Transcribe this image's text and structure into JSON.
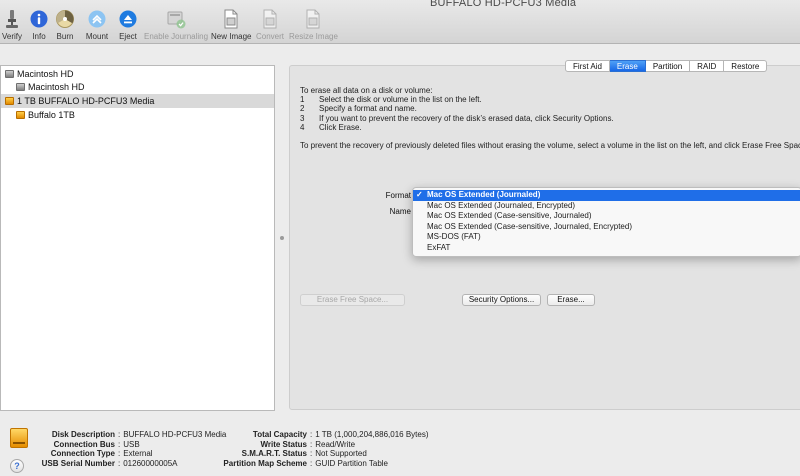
{
  "window": {
    "title": "BUFFALO HD-PCFU3 Media"
  },
  "toolbar": {
    "items": [
      {
        "label": "Verify",
        "icon": "microscope-icon",
        "enabled": true
      },
      {
        "label": "Info",
        "icon": "info-icon",
        "enabled": true
      },
      {
        "label": "Burn",
        "icon": "burn-icon",
        "enabled": true
      },
      {
        "label": "Mount",
        "icon": "mount-icon",
        "enabled": true
      },
      {
        "label": "Eject",
        "icon": "eject-icon",
        "enabled": true
      },
      {
        "label": "Enable Journaling",
        "icon": "journaling-icon",
        "enabled": false
      },
      {
        "label": "New Image",
        "icon": "new-image-icon",
        "enabled": true
      },
      {
        "label": "Convert",
        "icon": "convert-icon",
        "enabled": false
      },
      {
        "label": "Resize Image",
        "icon": "resize-image-icon",
        "enabled": false
      }
    ]
  },
  "sidebar": {
    "items": [
      {
        "label": "Macintosh HD",
        "type": "disk",
        "color": "gray",
        "indent": 0,
        "selected": false
      },
      {
        "label": "Macintosh HD",
        "type": "volume",
        "color": "gray",
        "indent": 1,
        "selected": false
      },
      {
        "label": "1 TB BUFFALO HD-PCFU3 Media",
        "type": "disk",
        "color": "orange",
        "indent": 0,
        "selected": true
      },
      {
        "label": "Buffalo 1TB",
        "type": "volume",
        "color": "orange",
        "indent": 1,
        "selected": false
      }
    ]
  },
  "tabs": [
    {
      "label": "First Aid",
      "active": false
    },
    {
      "label": "Erase",
      "active": true
    },
    {
      "label": "Partition",
      "active": false
    },
    {
      "label": "RAID",
      "active": false
    },
    {
      "label": "Restore",
      "active": false
    }
  ],
  "erase": {
    "intro": "To erase all data on a disk or volume:",
    "steps": [
      {
        "num": "1",
        "text": "Select the disk or volume in the list on the left."
      },
      {
        "num": "2",
        "text": "Specify a format and name."
      },
      {
        "num": "3",
        "text": "If you want to prevent the recovery of the disk’s erased data, click Security Options."
      },
      {
        "num": "4",
        "text": "Click Erase."
      }
    ],
    "prevent_text": "To prevent the recovery of previously deleted files without erasing the volume, select a volume in the list on the left, and click Erase Free Space.",
    "format_label": "Format",
    "name_label": "Name",
    "format_options": [
      {
        "label": "Mac OS Extended (Journaled)",
        "selected": true
      },
      {
        "label": "Mac OS Extended (Journaled, Encrypted)",
        "selected": false
      },
      {
        "label": "Mac OS Extended (Case-sensitive, Journaled)",
        "selected": false
      },
      {
        "label": "Mac OS Extended (Case-sensitive, Journaled, Encrypted)",
        "selected": false
      },
      {
        "label": "MS-DOS (FAT)",
        "selected": false
      },
      {
        "label": "ExFAT",
        "selected": false
      }
    ],
    "check_mark": "✓",
    "erase_free_space_label": "Erase Free Space...",
    "security_options_label": "Security Options...",
    "erase_label": "Erase..."
  },
  "info": {
    "left": [
      {
        "key": "Disk Description",
        "value": "BUFFALO HD-PCFU3 Media"
      },
      {
        "key": "Connection Bus",
        "value": "USB"
      },
      {
        "key": "Connection Type",
        "value": "External"
      },
      {
        "key": "USB Serial Number",
        "value": "01260000005A"
      }
    ],
    "right": [
      {
        "key": "Total Capacity",
        "value": "1 TB (1,000,204,886,016 Bytes)"
      },
      {
        "key": "Write Status",
        "value": "Read/Write"
      },
      {
        "key": "S.M.A.R.T. Status",
        "value": "Not Supported"
      },
      {
        "key": "Partition Map Scheme",
        "value": "GUID Partition Table"
      }
    ],
    "help_label": "?"
  },
  "colors": {
    "accent": "#1f6ee8",
    "disk_orange": "#f0a000"
  }
}
